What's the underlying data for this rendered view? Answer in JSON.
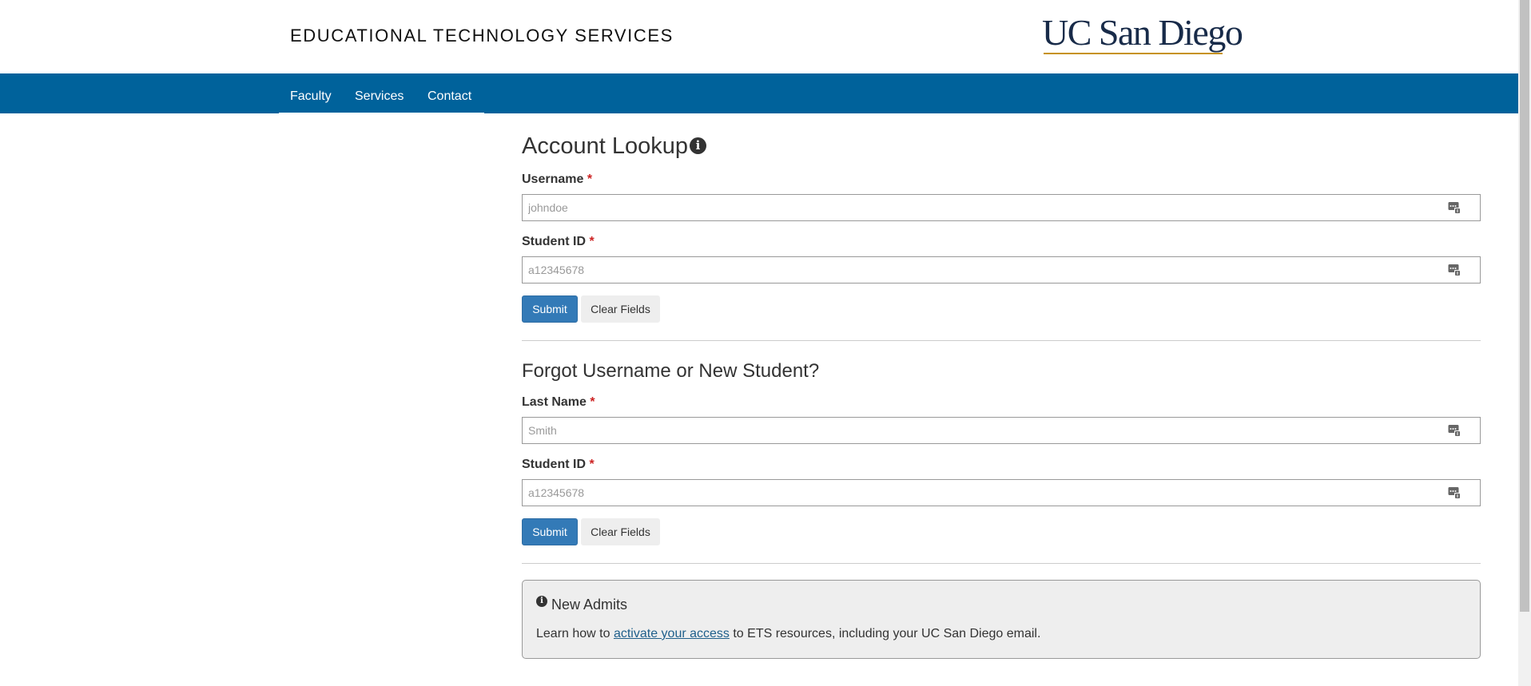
{
  "header": {
    "department": "EDUCATIONAL TECHNOLOGY SERVICES",
    "logo_text": "UC San Diego"
  },
  "nav": {
    "items": [
      {
        "label": "Faculty"
      },
      {
        "label": "Services"
      },
      {
        "label": "Contact"
      }
    ]
  },
  "account_lookup": {
    "title": "Account Lookup",
    "username": {
      "label": "Username",
      "required": "*",
      "placeholder": "johndoe"
    },
    "student_id": {
      "label": "Student ID",
      "required": "*",
      "placeholder": "a12345678"
    },
    "submit_label": "Submit",
    "clear_label": "Clear Fields"
  },
  "forgot": {
    "title": "Forgot Username or New Student?",
    "last_name": {
      "label": "Last Name",
      "required": "*",
      "placeholder": "Smith"
    },
    "student_id": {
      "label": "Student ID",
      "required": "*",
      "placeholder": "a12345678"
    },
    "submit_label": "Submit",
    "clear_label": "Clear Fields"
  },
  "new_admits": {
    "title": "New Admits",
    "text_before": "Learn how to ",
    "link_text": "activate your access",
    "text_after": " to ETS resources, including your UC San Diego email."
  },
  "colors": {
    "nav_bg": "#00629b",
    "primary_button": "#337ab7",
    "required_marker": "#cc2222",
    "logo_navy": "#182b49",
    "logo_gold": "#c69214"
  },
  "icons": {
    "field_autofill": "password-manager-icon",
    "title_info": "info-circle-icon",
    "alert_info": "info-circle-icon"
  }
}
